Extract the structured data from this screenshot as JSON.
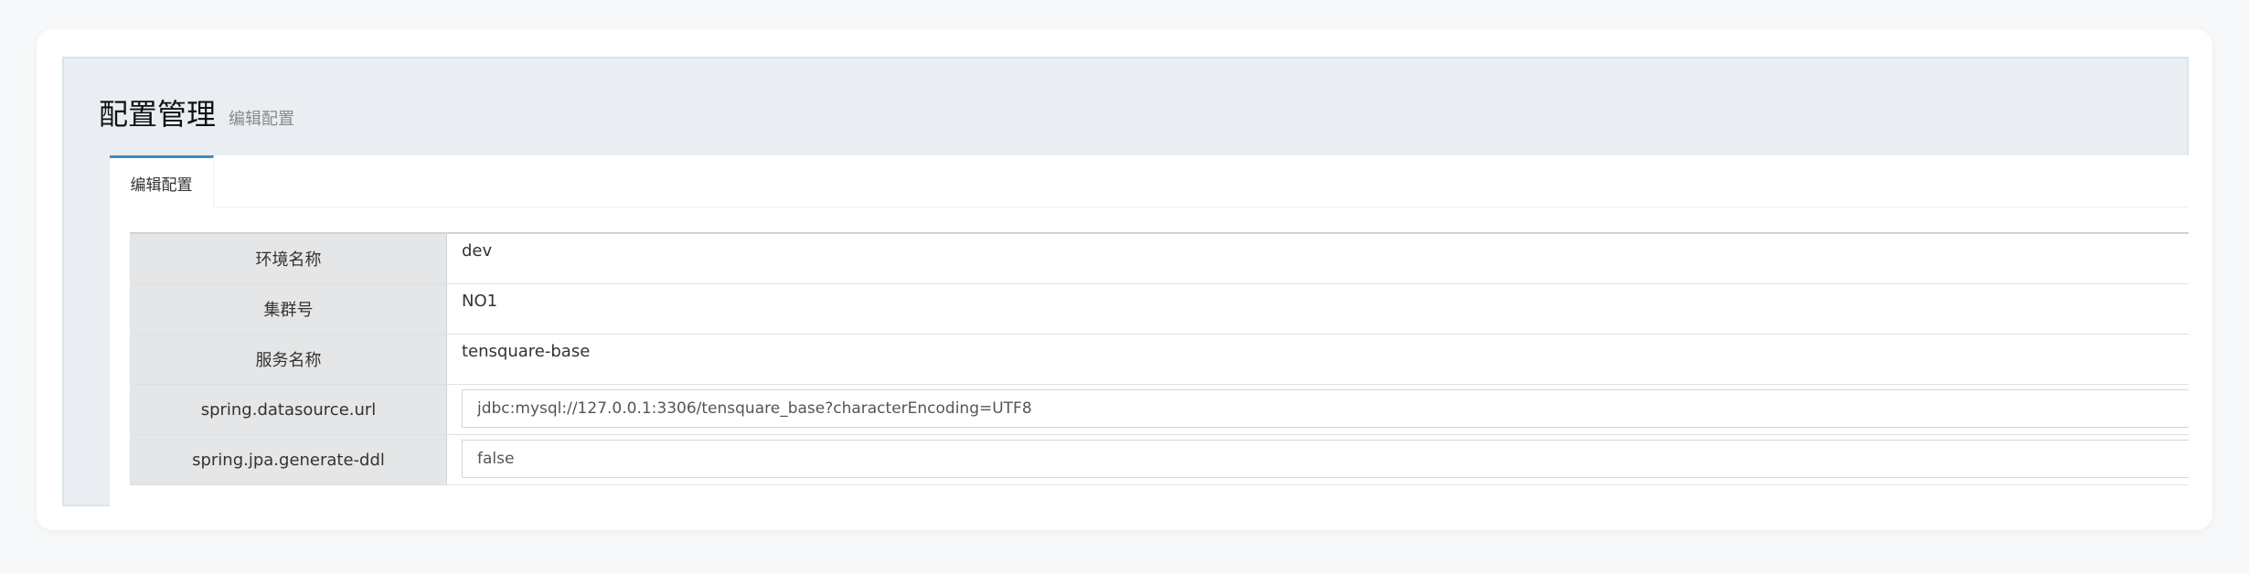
{
  "header": {
    "title": "配置管理",
    "subtitle": "编辑配置"
  },
  "tabs": [
    {
      "label": "编辑配置",
      "active": true
    }
  ],
  "form": {
    "rows": [
      {
        "label": "环境名称",
        "value": "dev",
        "kind": "text"
      },
      {
        "label": "集群号",
        "value": "NO1",
        "kind": "text"
      },
      {
        "label": "服务名称",
        "value": "tensquare-base",
        "kind": "text"
      },
      {
        "label": "spring.datasource.url",
        "value": "jdbc:mysql://127.0.0.1:3306/tensquare_base?characterEncoding=UTF8",
        "kind": "input"
      },
      {
        "label": "spring.jpa.generate-ddl",
        "value": "false",
        "kind": "input"
      }
    ]
  },
  "colors": {
    "accent": "#3c8dbc",
    "panel_bg": "#eaeef2",
    "label_bg": "#e5e6e7"
  }
}
